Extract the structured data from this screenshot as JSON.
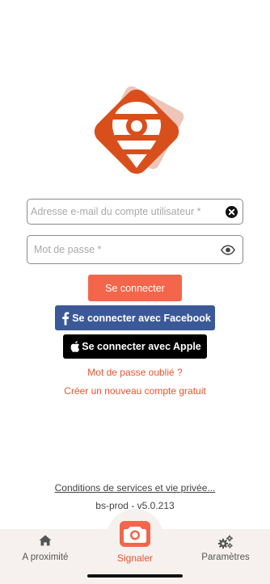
{
  "colors": {
    "accent": "#f3664b",
    "brand_orange": "#d94f1c",
    "facebook": "#3b5998",
    "apple": "#000000",
    "link": "#e8532e",
    "tabbar_bg": "#f6f1ef"
  },
  "logo": {
    "icon": "location-pin-logo"
  },
  "form": {
    "email": {
      "value": "",
      "placeholder": "Adresse e-mail du compte utilisateur *",
      "clear_icon": "clear-circle-icon"
    },
    "password": {
      "value": "",
      "placeholder": "Mot de passe *",
      "toggle_icon": "eye-icon"
    },
    "login_label": "Se connecter",
    "facebook_label": "Se connecter avec Facebook",
    "apple_label": "Se connecter avec Apple",
    "forgot_label": "Mot de passe oublié ?",
    "create_label": "Créer un nouveau compte gratuit"
  },
  "footer": {
    "terms_label": "Conditions de services et vie privée...",
    "version": "bs-prod - v5.0.213"
  },
  "tabs": [
    {
      "label": "A proximité",
      "icon": "home-icon",
      "active": false
    },
    {
      "label": "Signaler",
      "icon": "camera-icon",
      "active": true
    },
    {
      "label": "Paramètres",
      "icon": "gears-icon",
      "active": false
    }
  ]
}
